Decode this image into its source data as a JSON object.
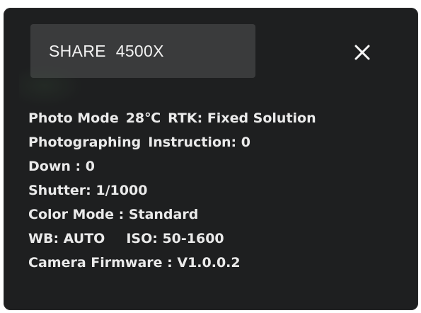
{
  "header": {
    "brand": "SHARE",
    "model": "4500X"
  },
  "close_icon": "close-icon",
  "info": {
    "photo_mode": "Photo Mode",
    "temperature": "28℃",
    "rtk": "RTK: Fixed Solution",
    "photographing": "Photographing",
    "instruction": "Instruction: 0",
    "down": "Down : 0",
    "shutter": "Shutter: 1/1000",
    "color_mode": "Color Mode : Standard",
    "wb": "WB: AUTO",
    "iso": "ISO: 50-1600",
    "firmware": "Camera Firmware : V1.0.0.2"
  },
  "colors": {
    "panel_bg": "#1e1f20",
    "header_bg": "#3a3b3c",
    "text": "#eaeaea"
  }
}
